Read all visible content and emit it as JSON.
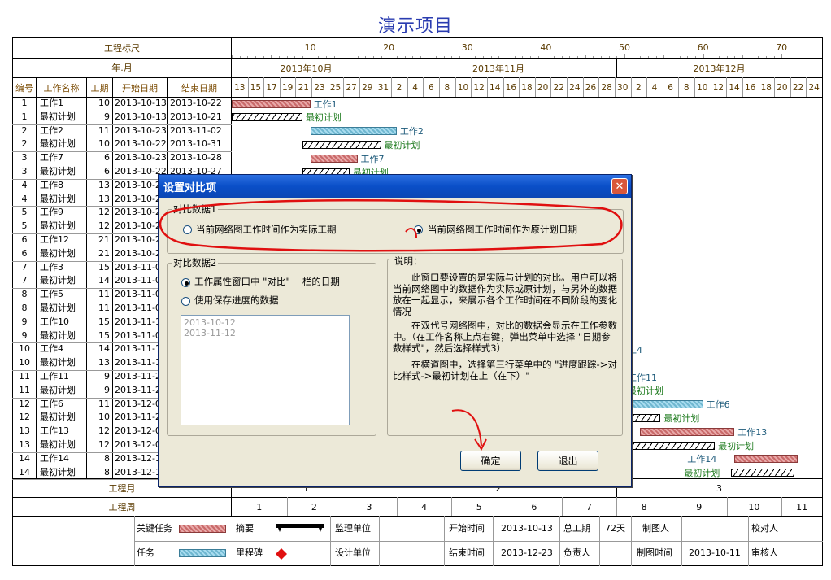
{
  "project_title": "演示项目",
  "header": {
    "scale_label": "工程标尺",
    "yearmonth_label": "年.月",
    "col_id": "编号",
    "col_name": "工作名称",
    "col_duration": "工期",
    "col_start": "开始日期",
    "col_end": "结束日期",
    "scale_ticks": [
      "10",
      "20",
      "30",
      "40",
      "50",
      "60",
      "70"
    ],
    "months": [
      "2013年10月",
      "2013年11月",
      "2013年12月"
    ],
    "days": [
      "13",
      "15",
      "17",
      "19",
      "21",
      "23",
      "25",
      "27",
      "29",
      "31",
      "2",
      "4",
      "6",
      "8",
      "10",
      "12",
      "14",
      "16",
      "18",
      "20",
      "22",
      "24",
      "26",
      "28",
      "30",
      "2",
      "4",
      "6",
      "8",
      "10",
      "12",
      "14",
      "16",
      "18",
      "20",
      "22",
      "24"
    ]
  },
  "rows": [
    {
      "id": "1",
      "name": "工作1",
      "dur": "10",
      "start": "2013-10-13",
      "end": "2013-10-22"
    },
    {
      "id": "1",
      "name": "最初计划",
      "dur": "9",
      "start": "2013-10-13",
      "end": "2013-10-21"
    },
    {
      "id": "2",
      "name": "工作2",
      "dur": "11",
      "start": "2013-10-23",
      "end": "2013-11-02"
    },
    {
      "id": "2",
      "name": "最初计划",
      "dur": "10",
      "start": "2013-10-22",
      "end": "2013-10-31"
    },
    {
      "id": "3",
      "name": "工作7",
      "dur": "6",
      "start": "2013-10-23",
      "end": "2013-10-28"
    },
    {
      "id": "3",
      "name": "最初计划",
      "dur": "6",
      "start": "2013-10-22",
      "end": "2013-10-27"
    },
    {
      "id": "4",
      "name": "工作8",
      "dur": "13",
      "start": "2013-10-2",
      "end": ""
    },
    {
      "id": "4",
      "name": "最初计划",
      "dur": "13",
      "start": "2013-10-2",
      "end": ""
    },
    {
      "id": "5",
      "name": "工作9",
      "dur": "12",
      "start": "2013-10-2",
      "end": ""
    },
    {
      "id": "5",
      "name": "最初计划",
      "dur": "12",
      "start": "2013-10-2",
      "end": ""
    },
    {
      "id": "6",
      "name": "工作12",
      "dur": "21",
      "start": "2013-10-2",
      "end": ""
    },
    {
      "id": "6",
      "name": "最初计划",
      "dur": "21",
      "start": "2013-10-2",
      "end": ""
    },
    {
      "id": "7",
      "name": "工作3",
      "dur": "15",
      "start": "2013-11-0",
      "end": ""
    },
    {
      "id": "7",
      "name": "最初计划",
      "dur": "14",
      "start": "2013-11-0",
      "end": ""
    },
    {
      "id": "8",
      "name": "工作5",
      "dur": "11",
      "start": "2013-11-0",
      "end": ""
    },
    {
      "id": "8",
      "name": "最初计划",
      "dur": "11",
      "start": "2013-11-0",
      "end": ""
    },
    {
      "id": "9",
      "name": "工作10",
      "dur": "15",
      "start": "2013-11-1",
      "end": ""
    },
    {
      "id": "9",
      "name": "最初计划",
      "dur": "15",
      "start": "2013-11-0",
      "end": ""
    },
    {
      "id": "10",
      "name": "工作4",
      "dur": "14",
      "start": "2013-11-1",
      "end": ""
    },
    {
      "id": "10",
      "name": "最初计划",
      "dur": "13",
      "start": "2013-11-1",
      "end": ""
    },
    {
      "id": "11",
      "name": "工作11",
      "dur": "9",
      "start": "2013-11-2",
      "end": ""
    },
    {
      "id": "11",
      "name": "最初计划",
      "dur": "9",
      "start": "2013-11-2",
      "end": ""
    },
    {
      "id": "12",
      "name": "工作6",
      "dur": "11",
      "start": "2013-12-0",
      "end": ""
    },
    {
      "id": "12",
      "name": "最初计划",
      "dur": "10",
      "start": "2013-11-2",
      "end": ""
    },
    {
      "id": "13",
      "name": "工作13",
      "dur": "12",
      "start": "2013-12-0",
      "end": ""
    },
    {
      "id": "13",
      "name": "最初计划",
      "dur": "12",
      "start": "2013-12-0",
      "end": ""
    },
    {
      "id": "14",
      "name": "工作14",
      "dur": "8",
      "start": "2013-12-1",
      "end": ""
    },
    {
      "id": "14",
      "name": "最初计划",
      "dur": "8",
      "start": "2013-12-1",
      "end": ""
    }
  ],
  "gantt_labels": [
    {
      "text": "工作1",
      "style": "red"
    },
    {
      "text": "最初计划",
      "style": "plan"
    },
    {
      "text": "工作2",
      "style": "blue"
    },
    {
      "text": "最初计划",
      "style": "plan"
    },
    {
      "text": "工作7",
      "style": "red"
    },
    {
      "text": "最初计划",
      "style": "plan"
    },
    {
      "text": "工4",
      "style": "none"
    },
    {
      "text": "工作11",
      "style": "red"
    },
    {
      "text": "最初计划",
      "style": "none"
    },
    {
      "text": "工作6",
      "style": "blue"
    },
    {
      "text": "最初计划",
      "style": "plan"
    },
    {
      "text": "工作13",
      "style": "red"
    },
    {
      "text": "最初计划",
      "style": "plan"
    },
    {
      "text": "工作14",
      "style": "red"
    },
    {
      "text": "最初计划",
      "style": "plan"
    }
  ],
  "footer": {
    "month_label": "工程月",
    "week_label": "工程周",
    "months": [
      "1",
      "2",
      "3"
    ],
    "weeks": [
      "1",
      "2",
      "3",
      "4",
      "5",
      "6",
      "7",
      "8",
      "9",
      "10",
      "11"
    ],
    "legend_critical": "关键任务",
    "legend_summary": "摘要",
    "legend_task": "任务",
    "legend_milestone": "里程碑",
    "supervisor": "监理单位",
    "designer": "设计单位",
    "start_time_label": "开始时间",
    "start_time": "2013-10-13",
    "end_time_label": "结束时间",
    "end_time": "2013-12-23",
    "total_label": "总工期",
    "total": "72天",
    "owner_label": "负责人",
    "maker_label": "制图人",
    "make_time_label": "制图时间",
    "make_time": "2013-10-11",
    "checker_label": "校对人",
    "reviewer_label": "审核人"
  },
  "dialog": {
    "title": "设置对比项",
    "close_glyph": "✕",
    "group1_title": "对比数据1",
    "g1_opt1": "当前网络图工作时间作为实际工期",
    "g1_opt2": "当前网络图工作时间作为原计划日期",
    "g1_selected": 2,
    "group2_title": "对比数据2",
    "g2_opt1": "工作属性窗口中 \"对比\" 一栏的日期",
    "g2_opt2": "使用保存进度的数据",
    "g2_selected": 1,
    "saved_list": [
      "2013-10-12",
      "2013-11-12"
    ],
    "desc_title": "说明：",
    "desc_p1": "此窗口要设置的是实际与计划的对比。用户可以将当前网络图中的数据作为实际或原计划，与另外的数据放在一起显示，来展示各个工作时间在不同阶段的变化情况",
    "desc_p2": "在双代号网络图中，对比的数据会显示在工作参数中。（在工作名称上点右键，弹出菜单中选择 \"日期参数样式\"，然后选择样式3）",
    "desc_p3": "在横道图中，选择第三行菜单中的 \"进度跟踪->对比样式->最初计划在上（在下）\"",
    "ok_label": "确定",
    "cancel_label": "退出"
  },
  "colors": {
    "title": "#2a3cb0",
    "critical_bar": "#c96a6a",
    "task_bar": "#6fb7d0",
    "label_green": "#1d7a1d",
    "annotation": "#e01010",
    "dialog_titlebar": "#0a4fc8"
  }
}
